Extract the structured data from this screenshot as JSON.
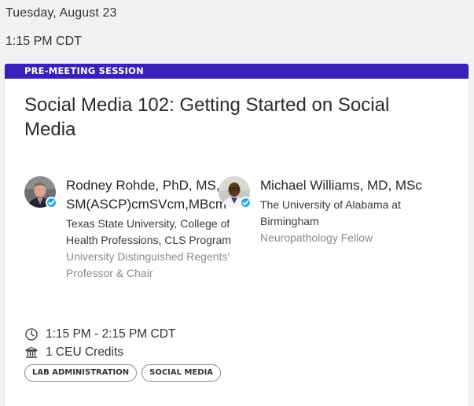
{
  "header": {
    "date": "Tuesday, August 23",
    "time": "1:15 PM CDT"
  },
  "session": {
    "banner_label": "PRE-MEETING SESSION",
    "banner_color": "#3a1fb8",
    "title": "Social Media 102: Getting Started on Social Media",
    "speakers": [
      {
        "name": "Rodney Rohde, PhD, MS, SM(ASCP)cmSVcm,MBcm",
        "organization": "Texas State University, College of Health Professions, CLS Program",
        "role": "University Distinguished Regents' Professor & Chair",
        "avatar_icon": "person-photo-icon",
        "verified_icon": "verified-check-icon"
      },
      {
        "name": "Michael Williams, MD, MSc",
        "organization": "The University of Alabama at Birmingham",
        "role": "Neuropathology Fellow",
        "avatar_icon": "person-photo-icon",
        "verified_icon": "verified-check-icon"
      }
    ],
    "time_range": "1:15 PM - 2:15 PM CDT",
    "time_icon": "clock-icon",
    "credits": "1 CEU Credits",
    "credits_icon": "institution-icon",
    "tags": [
      "LAB ADMINISTRATION",
      "SOCIAL MEDIA"
    ]
  }
}
